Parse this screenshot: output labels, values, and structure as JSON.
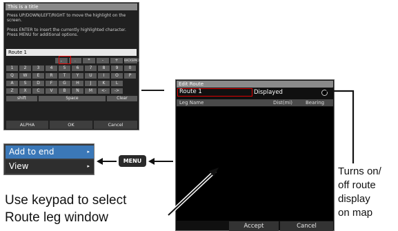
{
  "keyboard_dialog": {
    "title": "This is a title",
    "instructions_1": "Press UP/DOWN/LEFT/RIGHT to move the highlight on the screen.",
    "instructions_2": "Press ENTER to insert the currently highlighted character. Press MENU for additional options.",
    "input_value": "Route 1",
    "rows": [
      [
        "",
        "",
        "",
        ",",
        ".",
        "*",
        "-",
        "+",
        "BACKSPACE"
      ],
      [
        "1",
        "2",
        "3",
        "4",
        "5",
        "6",
        "7",
        "8",
        "9",
        "0"
      ],
      [
        "Q",
        "W",
        "E",
        "R",
        "T",
        "Y",
        "U",
        "I",
        "O",
        "P"
      ],
      [
        "A",
        "S",
        "D",
        "F",
        "G",
        "H",
        "J",
        "K",
        "L"
      ],
      [
        "Z",
        "X",
        "C",
        "V",
        "B",
        "N",
        "M",
        "<-",
        "->"
      ]
    ],
    "shift_label": "shift",
    "space_label": "Space",
    "clear_label": "Clear",
    "buttons": [
      "ALPHA",
      "OK",
      "Cancel"
    ]
  },
  "menu": {
    "items": [
      {
        "label": "Add to end",
        "arrow": "▸"
      },
      {
        "label": "View",
        "arrow": "▸"
      }
    ]
  },
  "menu_key_label": "MENU",
  "edit_route": {
    "title": "Edit Route",
    "name_value": "Route 1",
    "displayed_label": "Displayed",
    "col_leg_name": "Leg Name",
    "col_dist": "Dist(mi)",
    "col_bearing": "Bearing",
    "accept_label": "Accept",
    "cancel_label": "Cancel"
  },
  "annotations": {
    "keypad_line1": "Use keypad to select",
    "keypad_line2": "Route leg window",
    "toggle_line1": "Turns on/",
    "toggle_line2": "off route",
    "toggle_line3": "display",
    "toggle_line4": "on map"
  },
  "colors": {
    "highlight_red": "#e00000",
    "menu_selected_blue": "#3b78b8",
    "dialog_bg": "#101010"
  }
}
